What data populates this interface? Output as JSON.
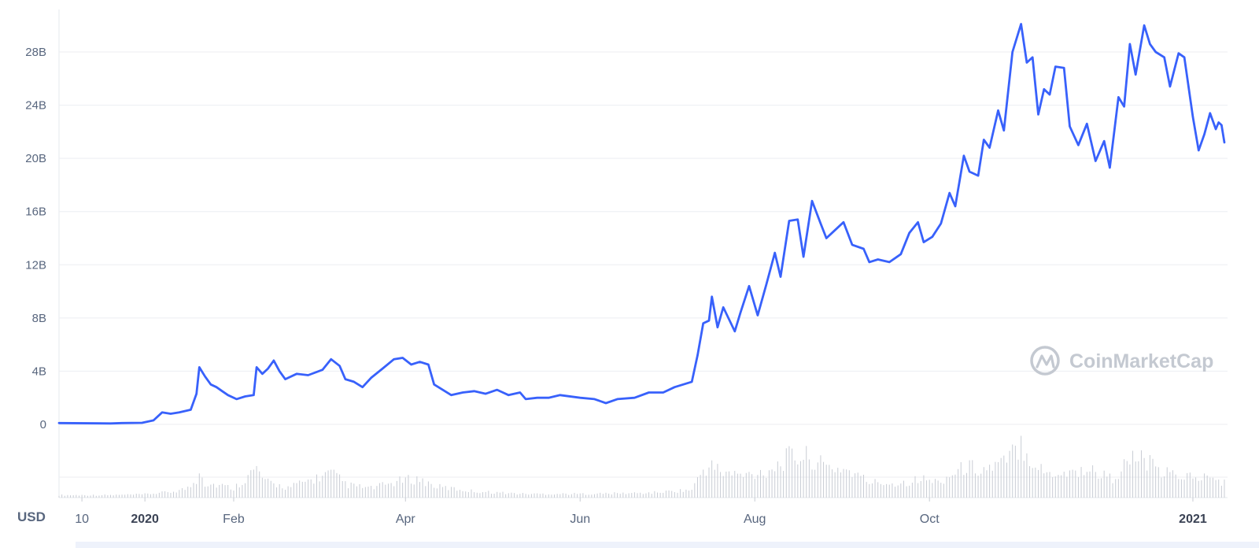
{
  "chart_data": {
    "type": "line",
    "title": "",
    "currency_label": "USD",
    "y_unit": "B",
    "ylim": [
      0,
      32
    ],
    "y_ticks": [
      {
        "value": 0,
        "label": "0"
      },
      {
        "value": 4,
        "label": "4B"
      },
      {
        "value": 8,
        "label": "8B"
      },
      {
        "value": 12,
        "label": "12B"
      },
      {
        "value": 16,
        "label": "16B"
      },
      {
        "value": 20,
        "label": "20B"
      },
      {
        "value": 24,
        "label": "24B"
      },
      {
        "value": 28,
        "label": "28B"
      }
    ],
    "x_start": "2019-12-02",
    "x_end": "2021-01-12",
    "x_ticks": [
      {
        "date": "2019-12-10",
        "label": "10",
        "bold": false
      },
      {
        "date": "2020-01-01",
        "label": "2020",
        "bold": true
      },
      {
        "date": "2020-02-01",
        "label": "Feb",
        "bold": false
      },
      {
        "date": "2020-04-01",
        "label": "Apr",
        "bold": false
      },
      {
        "date": "2020-06-01",
        "label": "Jun",
        "bold": false
      },
      {
        "date": "2020-08-01",
        "label": "Aug",
        "bold": false
      },
      {
        "date": "2020-10-01",
        "label": "Oct",
        "bold": false
      },
      {
        "date": "2021-01-01",
        "label": "2021",
        "bold": true
      }
    ],
    "grid": true,
    "line_color": "#3861fb",
    "volume_color": "#c8ccd4",
    "series": [
      {
        "points": [
          [
            "2019-12-02",
            0.1
          ],
          [
            "2019-12-20",
            0.07
          ],
          [
            "2019-12-24",
            0.1
          ],
          [
            "2019-12-31",
            0.12
          ],
          [
            "2020-01-04",
            0.3
          ],
          [
            "2020-01-07",
            0.9
          ],
          [
            "2020-01-10",
            0.8
          ],
          [
            "2020-01-13",
            0.9
          ],
          [
            "2020-01-17",
            1.1
          ],
          [
            "2020-01-19",
            2.3
          ],
          [
            "2020-01-20",
            4.3
          ],
          [
            "2020-01-22",
            3.6
          ],
          [
            "2020-01-24",
            3.0
          ],
          [
            "2020-01-26",
            2.8
          ],
          [
            "2020-01-28",
            2.5
          ],
          [
            "2020-01-30",
            2.2
          ],
          [
            "2020-02-02",
            1.9
          ],
          [
            "2020-02-05",
            2.1
          ],
          [
            "2020-02-08",
            2.2
          ],
          [
            "2020-02-09",
            4.3
          ],
          [
            "2020-02-11",
            3.8
          ],
          [
            "2020-02-13",
            4.2
          ],
          [
            "2020-02-15",
            4.8
          ],
          [
            "2020-02-17",
            4.0
          ],
          [
            "2020-02-19",
            3.4
          ],
          [
            "2020-02-23",
            3.8
          ],
          [
            "2020-02-27",
            3.7
          ],
          [
            "2020-03-03",
            4.1
          ],
          [
            "2020-03-06",
            4.9
          ],
          [
            "2020-03-09",
            4.4
          ],
          [
            "2020-03-11",
            3.4
          ],
          [
            "2020-03-14",
            3.2
          ],
          [
            "2020-03-17",
            2.8
          ],
          [
            "2020-03-20",
            3.5
          ],
          [
            "2020-03-24",
            4.2
          ],
          [
            "2020-03-28",
            4.9
          ],
          [
            "2020-03-31",
            5.0
          ],
          [
            "2020-04-03",
            4.5
          ],
          [
            "2020-04-06",
            4.7
          ],
          [
            "2020-04-09",
            4.5
          ],
          [
            "2020-04-11",
            3.0
          ],
          [
            "2020-04-14",
            2.6
          ],
          [
            "2020-04-17",
            2.2
          ],
          [
            "2020-04-21",
            2.4
          ],
          [
            "2020-04-25",
            2.5
          ],
          [
            "2020-04-29",
            2.3
          ],
          [
            "2020-05-03",
            2.6
          ],
          [
            "2020-05-07",
            2.2
          ],
          [
            "2020-05-11",
            2.4
          ],
          [
            "2020-05-13",
            1.9
          ],
          [
            "2020-05-17",
            2.0
          ],
          [
            "2020-05-21",
            2.0
          ],
          [
            "2020-05-25",
            2.2
          ],
          [
            "2020-06-01",
            2.0
          ],
          [
            "2020-06-06",
            1.9
          ],
          [
            "2020-06-10",
            1.6
          ],
          [
            "2020-06-14",
            1.9
          ],
          [
            "2020-06-20",
            2.0
          ],
          [
            "2020-06-25",
            2.4
          ],
          [
            "2020-06-30",
            2.4
          ],
          [
            "2020-07-04",
            2.8
          ],
          [
            "2020-07-10",
            3.2
          ],
          [
            "2020-07-12",
            5.2
          ],
          [
            "2020-07-14",
            7.6
          ],
          [
            "2020-07-16",
            7.8
          ],
          [
            "2020-07-17",
            9.6
          ],
          [
            "2020-07-19",
            7.3
          ],
          [
            "2020-07-21",
            8.8
          ],
          [
            "2020-07-25",
            7.0
          ],
          [
            "2020-07-27",
            8.4
          ],
          [
            "2020-07-30",
            10.4
          ],
          [
            "2020-08-02",
            8.2
          ],
          [
            "2020-08-05",
            10.5
          ],
          [
            "2020-08-08",
            12.9
          ],
          [
            "2020-08-10",
            11.1
          ],
          [
            "2020-08-13",
            15.3
          ],
          [
            "2020-08-16",
            15.4
          ],
          [
            "2020-08-18",
            12.6
          ],
          [
            "2020-08-21",
            16.8
          ],
          [
            "2020-08-24",
            15.1
          ],
          [
            "2020-08-26",
            14.0
          ],
          [
            "2020-08-28",
            14.4
          ],
          [
            "2020-09-01",
            15.2
          ],
          [
            "2020-09-04",
            13.5
          ],
          [
            "2020-09-08",
            13.2
          ],
          [
            "2020-09-10",
            12.2
          ],
          [
            "2020-09-13",
            12.4
          ],
          [
            "2020-09-17",
            12.2
          ],
          [
            "2020-09-21",
            12.8
          ],
          [
            "2020-09-24",
            14.4
          ],
          [
            "2020-09-27",
            15.2
          ],
          [
            "2020-09-29",
            13.7
          ],
          [
            "2020-10-02",
            14.1
          ],
          [
            "2020-10-05",
            15.1
          ],
          [
            "2020-10-08",
            17.4
          ],
          [
            "2020-10-10",
            16.4
          ],
          [
            "2020-10-13",
            20.2
          ],
          [
            "2020-10-15",
            19.0
          ],
          [
            "2020-10-18",
            18.7
          ],
          [
            "2020-10-20",
            21.4
          ],
          [
            "2020-10-22",
            20.8
          ],
          [
            "2020-10-25",
            23.6
          ],
          [
            "2020-10-27",
            22.1
          ],
          [
            "2020-10-30",
            28.0
          ],
          [
            "2020-11-02",
            30.1
          ],
          [
            "2020-11-04",
            27.2
          ],
          [
            "2020-11-06",
            27.6
          ],
          [
            "2020-11-08",
            23.3
          ],
          [
            "2020-11-10",
            25.2
          ],
          [
            "2020-11-12",
            24.8
          ],
          [
            "2020-11-14",
            26.9
          ],
          [
            "2020-11-17",
            26.8
          ],
          [
            "2020-11-19",
            22.4
          ],
          [
            "2020-11-22",
            21.0
          ],
          [
            "2020-11-25",
            22.6
          ],
          [
            "2020-11-28",
            19.8
          ],
          [
            "2020-12-01",
            21.3
          ],
          [
            "2020-12-03",
            19.3
          ],
          [
            "2020-12-06",
            24.6
          ],
          [
            "2020-12-08",
            23.9
          ],
          [
            "2020-12-10",
            28.6
          ],
          [
            "2020-12-12",
            26.3
          ],
          [
            "2020-12-15",
            30.0
          ],
          [
            "2020-12-17",
            28.6
          ],
          [
            "2020-12-19",
            28.0
          ],
          [
            "2020-12-22",
            27.6
          ],
          [
            "2020-12-24",
            25.4
          ],
          [
            "2020-12-27",
            27.9
          ],
          [
            "2020-12-29",
            27.6
          ],
          [
            "2021-01-01",
            23.1
          ],
          [
            "2021-01-03",
            20.6
          ],
          [
            "2021-01-05",
            21.8
          ],
          [
            "2021-01-07",
            23.4
          ],
          [
            "2021-01-09",
            22.2
          ],
          [
            "2021-01-10",
            22.7
          ],
          [
            "2021-01-11",
            22.5
          ],
          [
            "2021-01-12",
            21.2
          ]
        ]
      }
    ],
    "volume_bars": [
      [
        "2019-12-02",
        0.08
      ],
      [
        "2019-12-10",
        0.08
      ],
      [
        "2019-12-20",
        0.08
      ],
      [
        "2019-12-31",
        0.1
      ],
      [
        "2020-01-10",
        0.18
      ],
      [
        "2020-01-16",
        0.3
      ],
      [
        "2020-01-19",
        0.55
      ],
      [
        "2020-01-20",
        1.0
      ],
      [
        "2020-01-22",
        0.45
      ],
      [
        "2020-01-27",
        0.4
      ],
      [
        "2020-02-01",
        0.3
      ],
      [
        "2020-02-09",
        0.92
      ],
      [
        "2020-02-12",
        0.5
      ],
      [
        "2020-02-20",
        0.32
      ],
      [
        "2020-03-06",
        0.78
      ],
      [
        "2020-03-12",
        0.4
      ],
      [
        "2020-03-20",
        0.3
      ],
      [
        "2020-03-31",
        0.55
      ],
      [
        "2020-04-05",
        0.6
      ],
      [
        "2020-04-12",
        0.35
      ],
      [
        "2020-04-25",
        0.2
      ],
      [
        "2020-05-12",
        0.12
      ],
      [
        "2020-06-01",
        0.12
      ],
      [
        "2020-06-25",
        0.15
      ],
      [
        "2020-07-10",
        0.25
      ],
      [
        "2020-07-14",
        0.9
      ],
      [
        "2020-07-17",
        1.0
      ],
      [
        "2020-07-21",
        0.8
      ],
      [
        "2020-07-28",
        0.7
      ],
      [
        "2020-08-05",
        0.85
      ],
      [
        "2020-08-10",
        1.1
      ],
      [
        "2020-08-13",
        1.3
      ],
      [
        "2020-08-16",
        1.3
      ],
      [
        "2020-08-20",
        1.3
      ],
      [
        "2020-08-25",
        1.0
      ],
      [
        "2020-09-02",
        0.9
      ],
      [
        "2020-09-10",
        0.5
      ],
      [
        "2020-09-20",
        0.45
      ],
      [
        "2020-09-28",
        0.6
      ],
      [
        "2020-10-04",
        0.5
      ],
      [
        "2020-10-10",
        0.8
      ],
      [
        "2020-10-14",
        1.0
      ],
      [
        "2020-10-20",
        0.9
      ],
      [
        "2020-10-27",
        1.1
      ],
      [
        "2020-10-31",
        1.5
      ],
      [
        "2020-11-02",
        1.8
      ],
      [
        "2020-11-05",
        1.3
      ],
      [
        "2020-11-10",
        0.8
      ],
      [
        "2020-11-18",
        0.8
      ],
      [
        "2020-11-26",
        0.9
      ],
      [
        "2020-12-04",
        0.6
      ],
      [
        "2020-12-10",
        1.2
      ],
      [
        "2020-12-15",
        1.25
      ],
      [
        "2020-12-20",
        0.8
      ],
      [
        "2020-12-28",
        0.7
      ],
      [
        "2021-01-04",
        0.65
      ],
      [
        "2021-01-08",
        0.6
      ],
      [
        "2021-01-12",
        0.5
      ]
    ],
    "volume_max": 1.8
  },
  "branding": {
    "name": "CoinMarketCap"
  }
}
